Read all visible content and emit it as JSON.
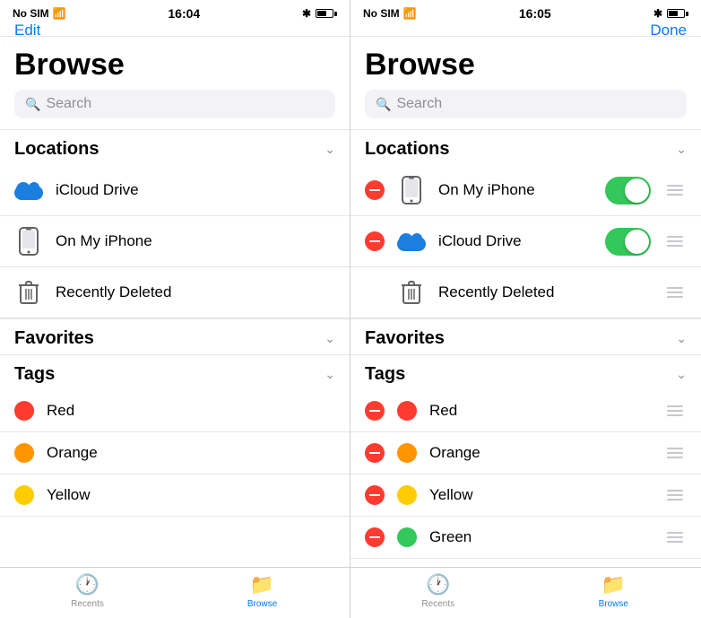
{
  "panel1": {
    "status": {
      "carrier": "No SIM",
      "time": "16:04",
      "bluetooth": "⌁",
      "battery": "60%"
    },
    "nav": {
      "edit_label": "Edit"
    },
    "browse_title": "Browse",
    "search_placeholder": "Search",
    "sections": [
      {
        "id": "locations",
        "title": "Locations",
        "items": [
          {
            "label": "iCloud Drive",
            "icon": "icloud"
          },
          {
            "label": "On My iPhone",
            "icon": "phone"
          },
          {
            "label": "Recently Deleted",
            "icon": "trash"
          }
        ]
      },
      {
        "id": "favorites",
        "title": "Favorites"
      },
      {
        "id": "tags",
        "title": "Tags",
        "items": [
          {
            "label": "Red",
            "color": "#ff3b30"
          },
          {
            "label": "Orange",
            "color": "#ff9500"
          },
          {
            "label": "Yellow",
            "color": "#ffcc00"
          }
        ]
      }
    ],
    "tabs": [
      {
        "id": "recents",
        "label": "Recents",
        "icon": "🕐",
        "active": false
      },
      {
        "id": "browse",
        "label": "Browse",
        "icon": "📁",
        "active": true
      }
    ]
  },
  "panel2": {
    "status": {
      "carrier": "No SIM",
      "time": "16:05",
      "bluetooth": "⌁",
      "battery": "60%"
    },
    "nav": {
      "done_label": "Done"
    },
    "browse_title": "Browse",
    "search_placeholder": "Search",
    "sections": [
      {
        "id": "locations",
        "title": "Locations",
        "items": [
          {
            "label": "On My iPhone",
            "icon": "phone",
            "toggle": true
          },
          {
            "label": "iCloud Drive",
            "icon": "icloud",
            "toggle": true
          },
          {
            "label": "Recently Deleted",
            "icon": "trash",
            "toggle": false
          }
        ]
      },
      {
        "id": "favorites",
        "title": "Favorites"
      },
      {
        "id": "tags",
        "title": "Tags",
        "items": [
          {
            "label": "Red",
            "color": "#ff3b30"
          },
          {
            "label": "Orange",
            "color": "#ff9500"
          },
          {
            "label": "Yellow",
            "color": "#ffcc00"
          },
          {
            "label": "Green",
            "color": "#34c759"
          }
        ]
      }
    ],
    "tabs": [
      {
        "id": "recents",
        "label": "Recents",
        "icon": "🕐",
        "active": false
      },
      {
        "id": "browse",
        "label": "Browse",
        "icon": "📁",
        "active": true
      }
    ]
  }
}
